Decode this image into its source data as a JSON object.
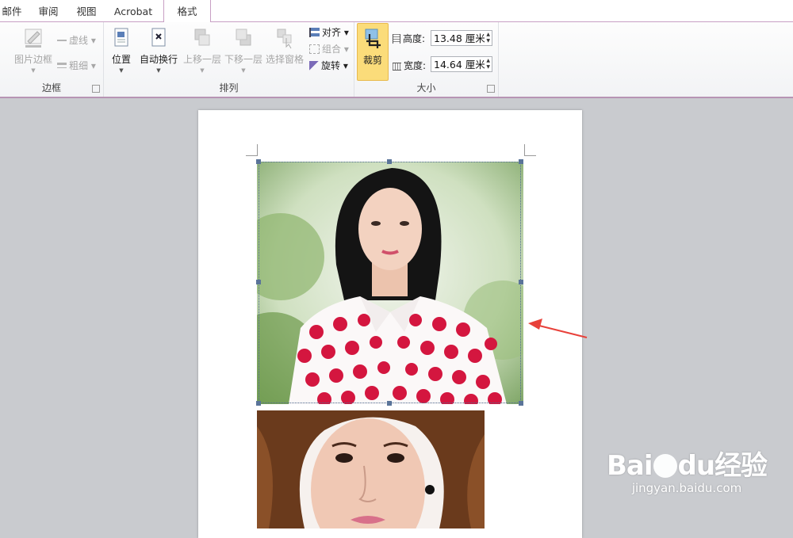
{
  "tabs": [
    "邮件",
    "审阅",
    "视图",
    "Acrobat",
    "格式"
  ],
  "active_tab": "格式",
  "groups": {
    "border": {
      "label": "边框",
      "picture_border": "图片边框",
      "dashes": "虚线",
      "weight": "粗细"
    },
    "arrange": {
      "label": "排列",
      "position": "位置",
      "wrap_text": "自动换行",
      "bring_forward": "上移一层",
      "send_backward": "下移一层",
      "selection_pane": "选择窗格",
      "align": "对齐",
      "group": "组合",
      "rotate": "旋转"
    },
    "size": {
      "label": "大小",
      "crop": "裁剪",
      "height_label": "高度:",
      "height_value": "13.48 厘米",
      "width_label": "宽度:",
      "width_value": "14.64 厘米"
    }
  },
  "watermark": {
    "brand": "Bai",
    "brand_suffix": "经验",
    "url": "jingyan.baidu.com"
  },
  "colors": {
    "accent": "#c8a0c4",
    "arrow": "#e8413a",
    "crop_highlight": "#fbdc7a"
  }
}
